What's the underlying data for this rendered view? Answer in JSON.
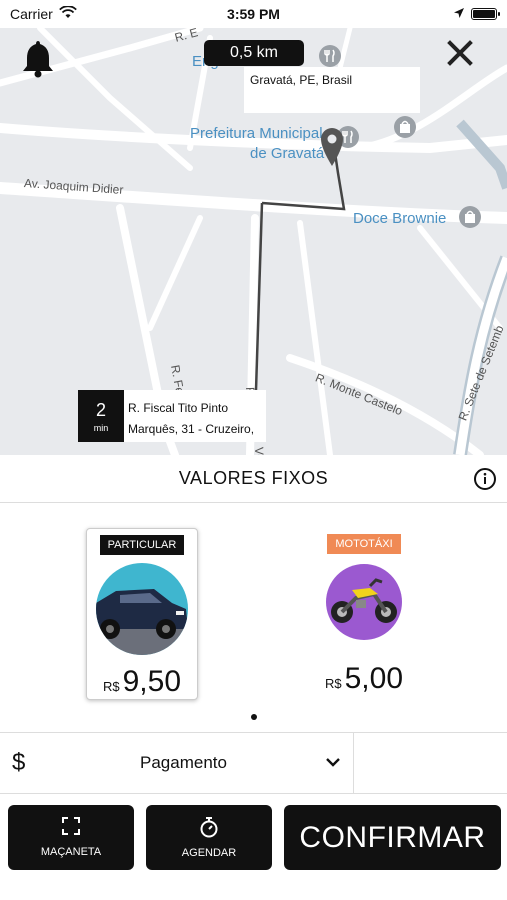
{
  "status_bar": {
    "carrier": "Carrier",
    "time": "3:59 PM",
    "battery_level": 1.0
  },
  "map": {
    "distance": "0,5 km",
    "destination": "Gravatá, PE, Brasil",
    "origin_minutes": "2",
    "origin_unit": "min",
    "origin_line1": "R. Fiscal Tito Pinto",
    "origin_line2": "Marquês, 31 - Cruzeiro,",
    "streets": {
      "joaquim": "Av. Joaquim Didier",
      "felix": "R. Felix",
      "monte": "R. Monte Castelo",
      "sete": "R. Sete de Setemb",
      "ve": "Ve",
      "r": "R",
      "top": "R. E"
    },
    "pois": {
      "engenho": "Engenho do Imo",
      "prefeitura1": "Prefeitura Municipal",
      "prefeitura2": "de Gravatá",
      "doce": "Doce Brownie"
    }
  },
  "sheet": {
    "title": "VALORES FIXOS",
    "options": [
      {
        "badge": "PARTICULAR",
        "currency": "R$",
        "value": "9,50",
        "selected": true
      },
      {
        "badge": "MOTOTÁXI",
        "currency": "R$",
        "value": "5,00",
        "selected": false
      }
    ],
    "payment": {
      "symbol": "$",
      "label": "Pagamento"
    }
  },
  "buttons": {
    "handle": "MAÇANETA",
    "schedule": "AGENDAR",
    "confirm": "CONFIRMAR"
  },
  "colors": {
    "accent_dark": "#111111",
    "moto_badge": "#f08a55",
    "map_bg": "#e8eaed",
    "poi_text": "#4a90c2"
  }
}
